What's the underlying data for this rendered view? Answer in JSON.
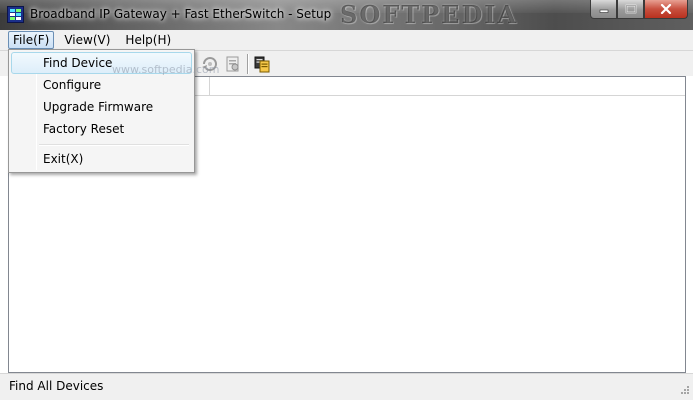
{
  "window": {
    "title": "Broadband IP Gateway + Fast EtherSwitch - Setup",
    "watermark": "SOFTPEDIA"
  },
  "menubar": {
    "items": [
      {
        "label": "File(F)",
        "active": true
      },
      {
        "label": "View(V)",
        "active": false
      },
      {
        "label": "Help(H)",
        "active": false
      }
    ]
  },
  "file_menu": {
    "items": [
      {
        "label": "Find Device",
        "highlighted": true
      },
      {
        "label": "Configure"
      },
      {
        "label": "Upgrade Firmware"
      },
      {
        "label": "Factory Reset"
      },
      {
        "label": "Exit(X)"
      }
    ],
    "watermark": "www.softpedia.com"
  },
  "toolbar": {
    "icons": [
      "refresh-icon",
      "settings-page-icon",
      "copy-devices-icon"
    ]
  },
  "statusbar": {
    "text": "Find All Devices"
  },
  "colors": {
    "menu_highlight": "#ddeefa",
    "menu_highlight_border": "#a8d8eb",
    "close_button": "#c8503f"
  }
}
